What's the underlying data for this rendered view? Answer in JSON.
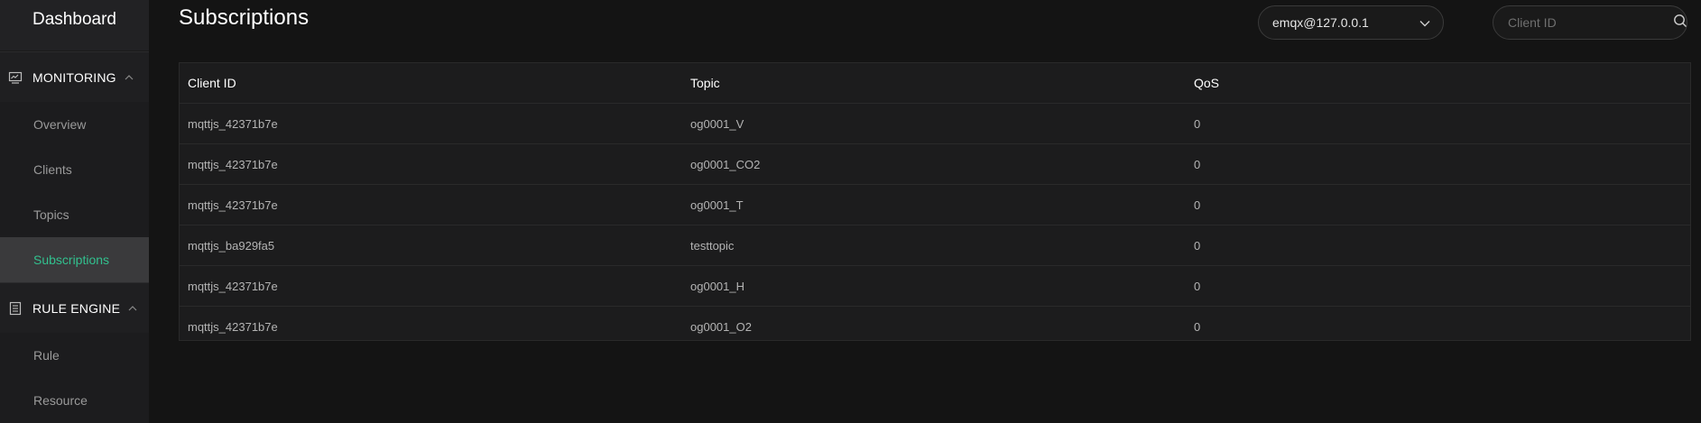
{
  "app": {
    "title": "Dashboard"
  },
  "sidebar": {
    "groups": [
      {
        "label": "MONITORING",
        "icon": "monitor-icon",
        "items": [
          "Overview",
          "Clients",
          "Topics",
          "Subscriptions"
        ]
      },
      {
        "label": "RULE ENGINE",
        "icon": "document-icon",
        "items": [
          "Rule",
          "Resource"
        ]
      }
    ],
    "active_item": "Subscriptions"
  },
  "page": {
    "title": "Subscriptions"
  },
  "node_select": {
    "value": "emqx@127.0.0.1"
  },
  "search": {
    "placeholder": "Client ID"
  },
  "table": {
    "headers": [
      "Client ID",
      "Topic",
      "QoS"
    ],
    "rows": [
      [
        "mqttjs_42371b7e",
        "og0001_V",
        "0"
      ],
      [
        "mqttjs_42371b7e",
        "og0001_CO2",
        "0"
      ],
      [
        "mqttjs_42371b7e",
        "og0001_T",
        "0"
      ],
      [
        "mqttjs_ba929fa5",
        "testtopic",
        "0"
      ],
      [
        "mqttjs_42371b7e",
        "og0001_H",
        "0"
      ],
      [
        "mqttjs_42371b7e",
        "og0001_O2",
        "0"
      ]
    ]
  },
  "colors": {
    "accent": "#32c08e",
    "background": "#141414",
    "sidebar": "#222224"
  }
}
